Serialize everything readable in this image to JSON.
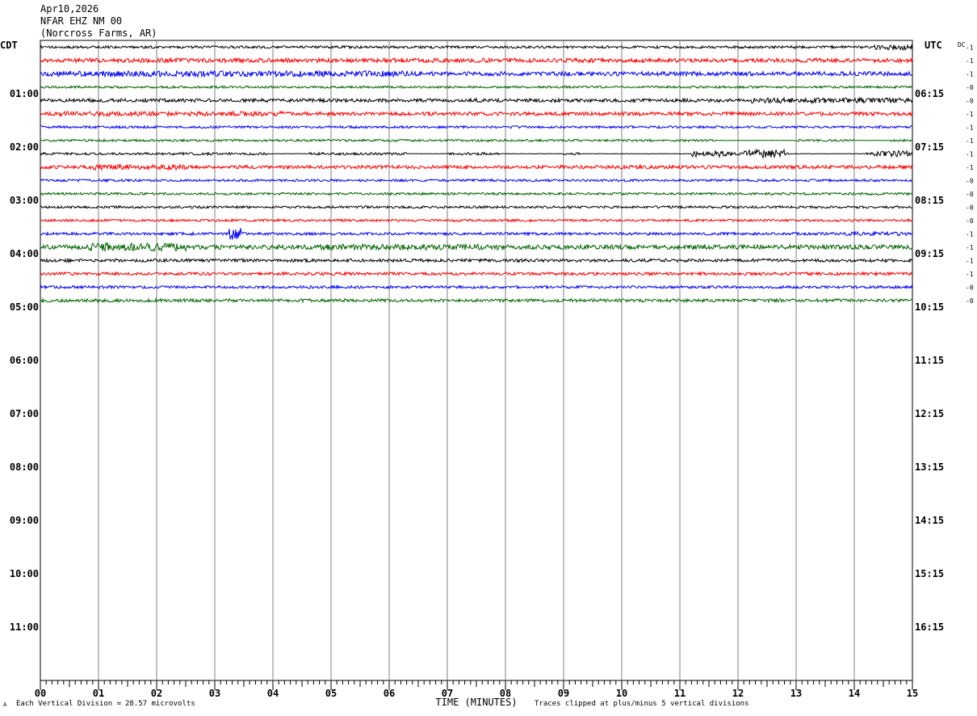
{
  "header": {
    "date": "Apr10,2026",
    "station": "NFAR EHZ NM 00",
    "location": "(Norcross Farms, AR)"
  },
  "chart_data": {
    "type": "line",
    "left_timezone": "CDT",
    "right_timezone": "UTC",
    "dc_label": "DC",
    "xlabel": "TIME (MINUTES)",
    "x_ticks": [
      "00",
      "01",
      "02",
      "03",
      "04",
      "05",
      "06",
      "07",
      "08",
      "09",
      "10",
      "11",
      "12",
      "13",
      "14",
      "15"
    ],
    "xlim": [
      0,
      15
    ],
    "left_hours": [
      "01:00",
      "02:00",
      "03:00",
      "04:00",
      "05:00",
      "06:00",
      "07:00",
      "08:00",
      "09:00",
      "10:00",
      "11:00"
    ],
    "right_hours": [
      "06:15",
      "07:15",
      "08:15",
      "09:15",
      "10:15",
      "11:15",
      "12:15",
      "13:15",
      "14:15",
      "15:15",
      "16:15"
    ],
    "rows_total": 48,
    "rows_per_hour": 4,
    "trace_colors": [
      "#000000",
      "#ff0000",
      "#0000ff",
      "#006400"
    ],
    "dc_offsets": [
      "-1",
      "-1",
      "-1",
      "-0",
      "-0",
      "-1",
      "-1",
      "-1",
      "-1",
      "-1",
      "-0",
      "-0",
      "-0",
      "-0",
      "-1",
      "-1",
      "-1",
      "-1",
      "-0",
      "-0"
    ],
    "trace_noise": [
      {
        "amp": 1.6,
        "bursts": [
          {
            "from": 14.3,
            "to": 15,
            "amp": 3.5
          }
        ]
      },
      {
        "amp": 2.6,
        "bursts": []
      },
      {
        "amp": 2.6,
        "bursts": [
          {
            "from": 0,
            "to": 6.5,
            "amp": 3.6
          }
        ]
      },
      {
        "amp": 1.4,
        "bursts": []
      },
      {
        "amp": 2.2,
        "bursts": [
          {
            "from": 12.2,
            "to": 15,
            "amp": 3.2
          }
        ]
      },
      {
        "amp": 2.3,
        "bursts": [
          {
            "from": 0,
            "to": 4.2,
            "amp": 3.0
          }
        ]
      },
      {
        "amp": 1.5,
        "bursts": []
      },
      {
        "amp": 1.4,
        "bursts": [],
        "quiet": [
          [
            11.6,
            13.0
          ],
          [
            14.0,
            14.6
          ]
        ]
      },
      {
        "amp": 1.6,
        "bursts": [
          {
            "from": 11.2,
            "to": 11.9,
            "amp": 4.0
          },
          {
            "from": 12.1,
            "to": 12.8,
            "amp": 5.0
          },
          {
            "from": 14.3,
            "to": 15,
            "amp": 3.8
          }
        ],
        "quiet": [
          [
            3.9,
            4.6
          ],
          [
            6.3,
            7.0
          ],
          [
            7.9,
            9.0
          ],
          [
            9.3,
            11.2
          ],
          [
            12.9,
            14.2
          ]
        ]
      },
      {
        "amp": 2.2,
        "bursts": [
          {
            "from": 0.8,
            "to": 2.5,
            "amp": 3.4
          }
        ]
      },
      {
        "amp": 1.5,
        "bursts": []
      },
      {
        "amp": 1.5,
        "bursts": []
      },
      {
        "amp": 1.5,
        "bursts": []
      },
      {
        "amp": 1.5,
        "bursts": []
      },
      {
        "amp": 1.7,
        "bursts": [
          {
            "from": 3.25,
            "to": 3.45,
            "amp": 8.0
          },
          {
            "from": 13.8,
            "to": 15,
            "amp": 2.4
          }
        ]
      },
      {
        "amp": 2.8,
        "bursts": [
          {
            "from": 0.8,
            "to": 2.5,
            "amp": 5.0
          },
          {
            "from": 4.8,
            "to": 8.0,
            "amp": 3.6
          }
        ]
      },
      {
        "amp": 2.0,
        "bursts": []
      },
      {
        "amp": 1.9,
        "bursts": []
      },
      {
        "amp": 1.7,
        "bursts": []
      },
      {
        "amp": 2.0,
        "bursts": []
      }
    ]
  },
  "footer": {
    "vertical_division": "Each Vertical Division =",
    "microvolts": "28.57 microvolts",
    "clipping": "Traces clipped at plus/minus 5 vertical divisions",
    "corner_mark": "A"
  }
}
